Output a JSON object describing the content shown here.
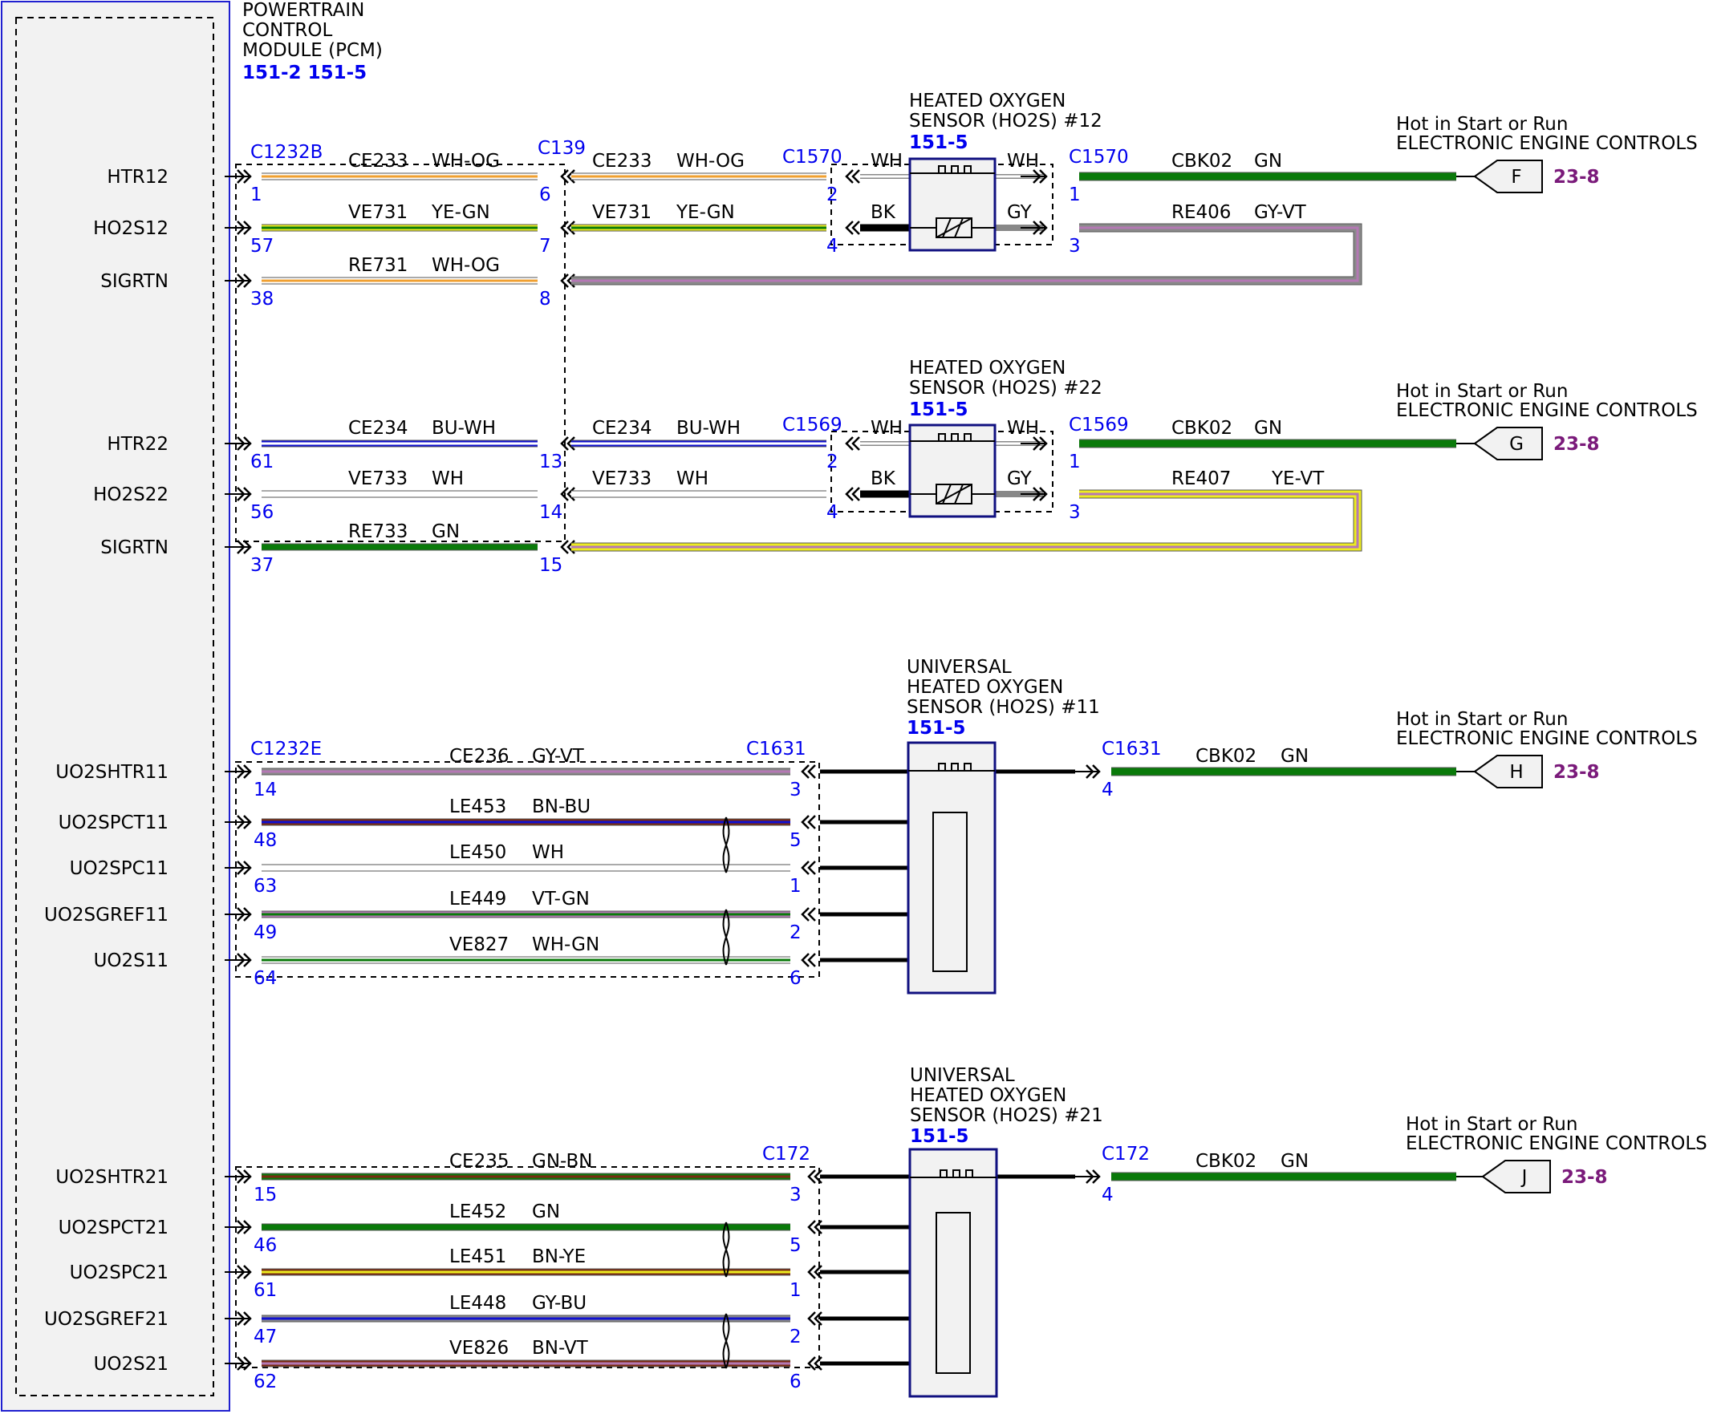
{
  "pcm": {
    "title_lines": [
      "POWERTRAIN",
      "CONTROL",
      "MODULE (PCM)"
    ],
    "refs": "151-2 151-5",
    "pins": [
      "HTR12",
      "HO2S12",
      "SIGRTN",
      "HTR22",
      "HO2S22",
      "SIGRTN",
      "UO2SHTR11",
      "UO2SPCT11",
      "UO2SPC11",
      "UO2SGREF11",
      "UO2S11",
      "UO2SHTR21",
      "UO2SPCT21",
      "UO2SPC21",
      "UO2SGREF21",
      "UO2S21"
    ]
  },
  "sensors": [
    {
      "title_lines": [
        "HEATED OXYGEN",
        "SENSOR (HO2S) #12"
      ],
      "ref": "151-5"
    },
    {
      "title_lines": [
        "HEATED OXYGEN",
        "SENSOR (HO2S) #22"
      ],
      "ref": "151-5"
    },
    {
      "title_lines": [
        "UNIVERSAL",
        "HEATED OXYGEN",
        "SENSOR (HO2S) #11"
      ],
      "ref": "151-5"
    },
    {
      "title_lines": [
        "UNIVERSAL",
        "HEATED OXYGEN",
        "SENSOR (HO2S) #21"
      ],
      "ref": "151-5"
    }
  ],
  "power_sources": [
    {
      "line1": "Hot in Start or Run",
      "line2": "ELECTRONIC ENGINE CONTROLS",
      "letter": "F",
      "page": "23-8"
    },
    {
      "line1": "Hot in Start or Run",
      "line2": "ELECTRONIC ENGINE CONTROLS",
      "letter": "G",
      "page": "23-8"
    },
    {
      "line1": "Hot in Start or Run",
      "line2": "ELECTRONIC ENGINE CONTROLS",
      "letter": "H",
      "page": "23-8"
    },
    {
      "line1": "Hot in Start or Run",
      "line2": "ELECTRONIC ENGINE CONTROLS",
      "letter": "J",
      "page": "23-8"
    }
  ],
  "connectors": {
    "pcm_a": "C1232B",
    "inline_a": "C139",
    "s12": "C1570",
    "s22": "C1569",
    "pcm_b": "C1232E",
    "s11": "C1631",
    "s21": "C172"
  },
  "circuits": [
    {
      "circuit": "CE233",
      "color": "WH-OG",
      "pin": "1",
      "pin2": "6"
    },
    {
      "circuit": "VE731",
      "color": "YE-GN",
      "pin": "57",
      "pin2": "7"
    },
    {
      "circuit": "RE731",
      "color": "WH-OG",
      "pin": "38",
      "pin2": "8"
    },
    {
      "circuit": "CE234",
      "color": "BU-WH",
      "pin": "61",
      "pin2": "13"
    },
    {
      "circuit": "VE733",
      "color": "WH",
      "pin": "56",
      "pin2": "14"
    },
    {
      "circuit": "RE733",
      "color": "GN",
      "pin": "37",
      "pin2": "15"
    },
    {
      "circuit": "CE236",
      "color": "GY-VT",
      "pin": "14",
      "pin2": "3"
    },
    {
      "circuit": "LE453",
      "color": "BN-BU",
      "pin": "48",
      "pin2": "5"
    },
    {
      "circuit": "LE450",
      "color": "WH",
      "pin": "63",
      "pin2": "1"
    },
    {
      "circuit": "LE449",
      "color": "VT-GN",
      "pin": "49",
      "pin2": "2"
    },
    {
      "circuit": "VE827",
      "color": "WH-GN",
      "pin": "64",
      "pin2": "6"
    },
    {
      "circuit": "CE235",
      "color": "GN-BN",
      "pin": "15",
      "pin2": "3"
    },
    {
      "circuit": "LE452",
      "color": "GN",
      "pin": "46",
      "pin2": "5"
    },
    {
      "circuit": "LE451",
      "color": "BN-YE",
      "pin": "61",
      "pin2": "1"
    },
    {
      "circuit": "LE448",
      "color": "GY-BU",
      "pin": "47",
      "pin2": "2"
    },
    {
      "circuit": "VE826",
      "color": "BN-VT",
      "pin": "62",
      "pin2": "6"
    }
  ],
  "inline_segments": [
    {
      "circuit": "CE233",
      "color": "WH-OG",
      "pin_end": "2"
    },
    {
      "circuit": "VE731",
      "color": "YE-GN",
      "pin_end": "4"
    },
    {
      "circuit": "CE234",
      "color": "BU-WH",
      "pin_end": "2"
    },
    {
      "circuit": "VE733",
      "color": "WH",
      "pin_end": "4"
    }
  ],
  "sensor_leads": [
    {
      "left": "WH",
      "right": "WH",
      "left2": "BK",
      "right2": "GY"
    },
    {
      "left": "WH",
      "right": "WH",
      "left2": "BK",
      "right2": "GY"
    }
  ],
  "feed_circuits": [
    {
      "circuit": "CBK02",
      "color": "GN",
      "pin": "1"
    },
    {
      "circuit": "CBK02",
      "color": "GN",
      "pin": "1"
    },
    {
      "circuit": "CBK02",
      "color": "GN",
      "pin": "4"
    },
    {
      "circuit": "CBK02",
      "color": "GN",
      "pin": "4"
    }
  ],
  "return_circuits": [
    {
      "circuit": "RE406",
      "color": "GY-VT",
      "pin": "3"
    },
    {
      "circuit": "RE407",
      "color": "YE-VT",
      "pin": "3"
    }
  ],
  "wire_colors": {
    "WH": "#ffffff",
    "OG": "#f0a030",
    "YE": "#ecec20",
    "GN": "#0a7a0a",
    "BU": "#1010d0",
    "GY": "#8a8a8a",
    "VT": "#b478b4",
    "BN": "#7a2a10",
    "BK": "#000000",
    "RD": "#d00000"
  }
}
